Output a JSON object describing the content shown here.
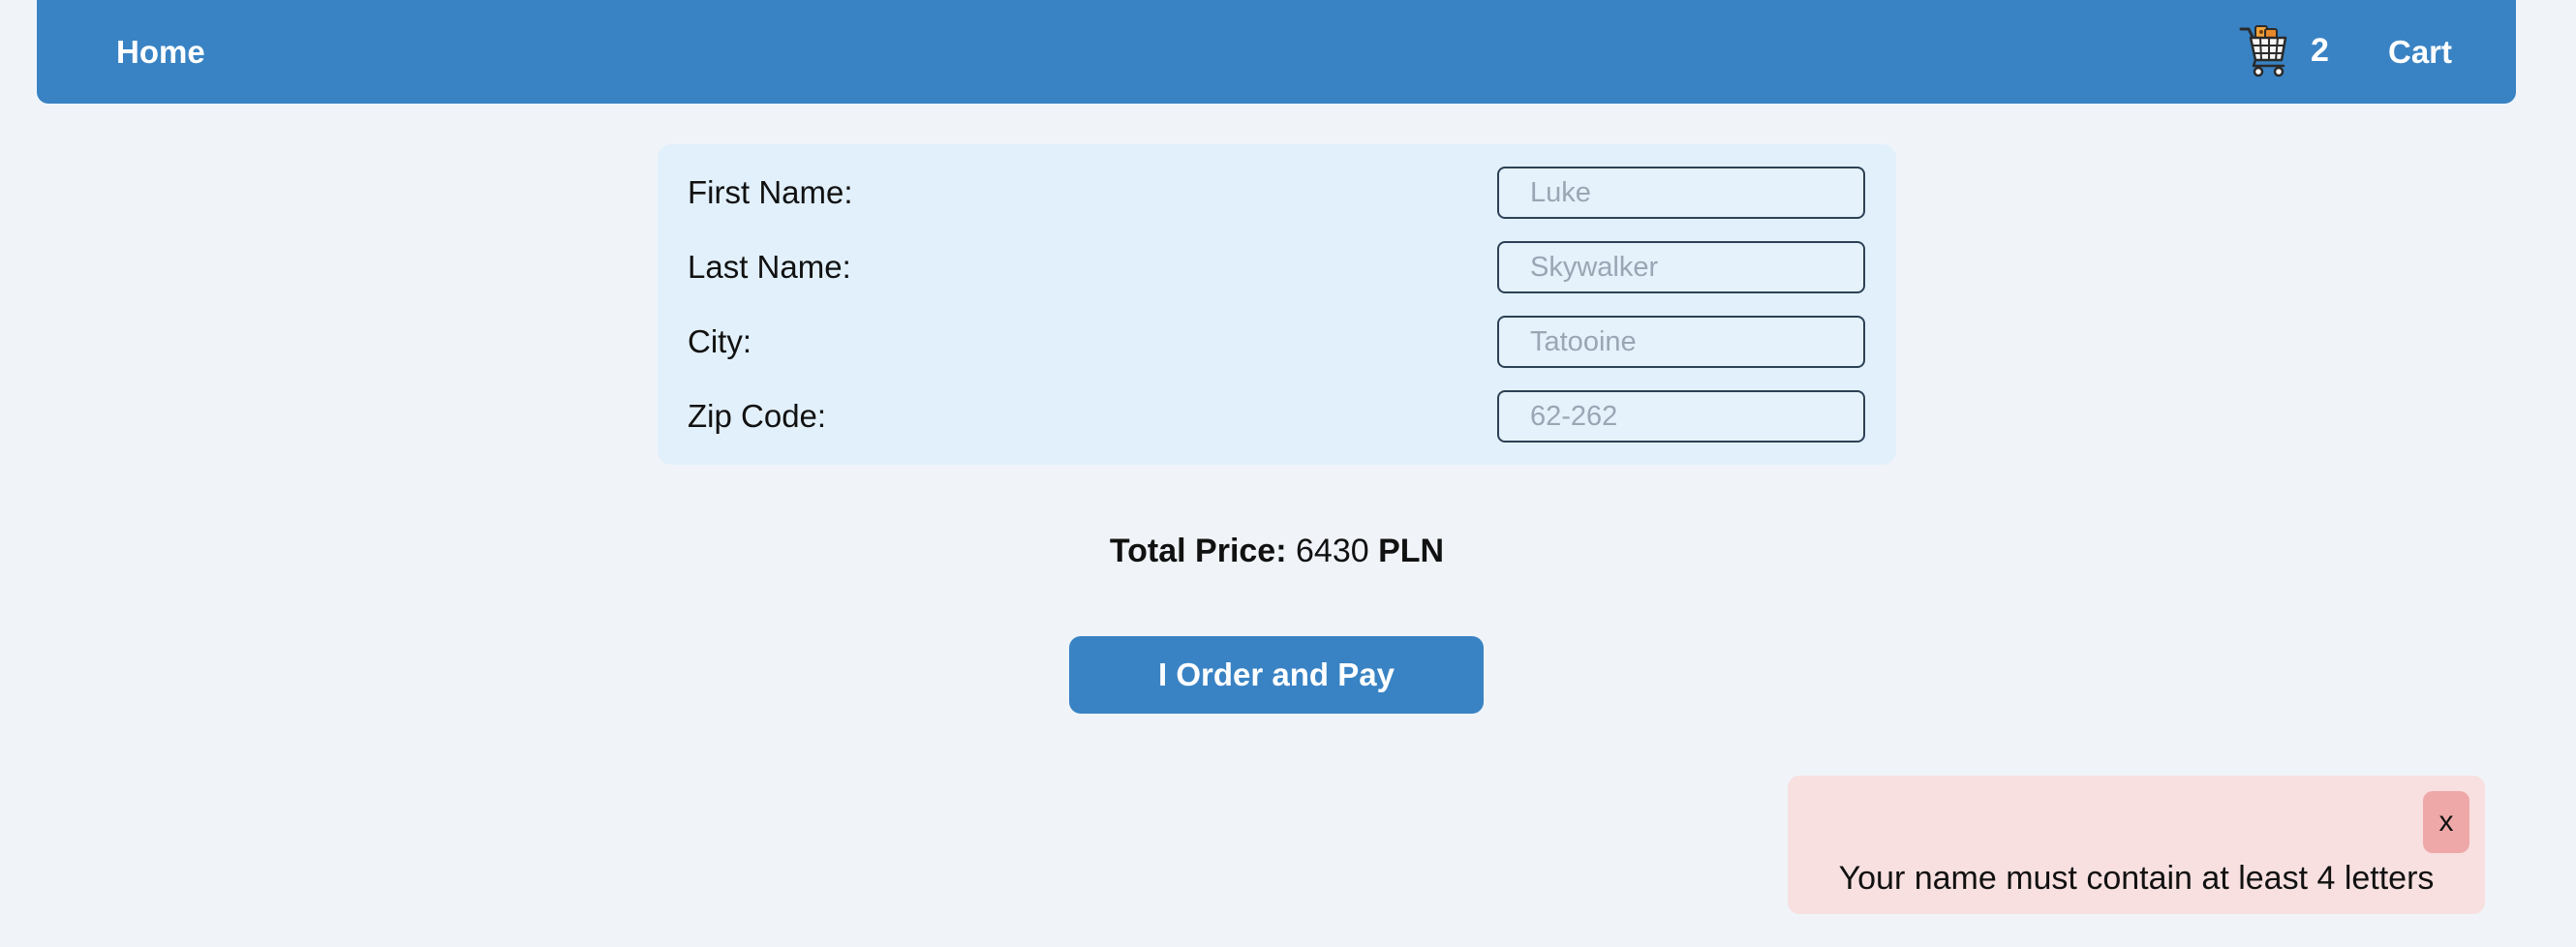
{
  "nav": {
    "home_label": "Home",
    "cart_count": "2",
    "cart_label": "Cart",
    "cart_icon": "shopping-cart-icon"
  },
  "form": {
    "fields": [
      {
        "label": "First Name:",
        "placeholder": "Luke",
        "value": ""
      },
      {
        "label": "Last Name:",
        "placeholder": "Skywalker",
        "value": ""
      },
      {
        "label": "City:",
        "placeholder": "Tatooine",
        "value": ""
      },
      {
        "label": "Zip Code:",
        "placeholder": "62-262",
        "value": ""
      }
    ]
  },
  "total": {
    "label": "Total Price:",
    "amount": "6430",
    "currency": "PLN"
  },
  "order_button_label": "I Order and Pay",
  "toast": {
    "close_label": "x",
    "message": "Your name must contain at least 4 letters"
  },
  "colors": {
    "primary": "#3983c4",
    "page_background": "#f0f4f9",
    "form_background": "#e2f0fb",
    "toast_background": "#f8e0e0",
    "toast_close_background": "#eea8a8"
  }
}
